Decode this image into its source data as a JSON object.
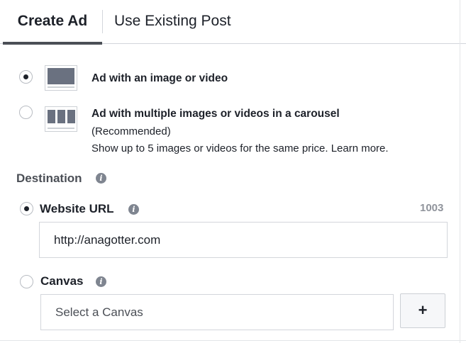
{
  "tabs": {
    "create_ad": "Create Ad",
    "use_existing_post": "Use Existing Post"
  },
  "format_options": {
    "single": {
      "title": "Ad with an image or video",
      "selected": true
    },
    "carousel": {
      "title": "Ad with multiple images or videos in a carousel",
      "recommended": "(Recommended)",
      "description": "Show up to 5 images or videos for the same price.",
      "learn_more": "Learn more.",
      "selected": false
    }
  },
  "destination": {
    "label": "Destination",
    "info_glyph": "i",
    "website_url": {
      "label": "Website URL",
      "char_counter": "1003",
      "value": "http://anagotter.com",
      "selected": true
    },
    "canvas": {
      "label": "Canvas",
      "placeholder": "Select a Canvas",
      "add_label": "+",
      "selected": false
    }
  },
  "colors": {
    "text": "#1d2129",
    "muted": "#90949c",
    "border": "#d3d6db",
    "icon": "#6a7180"
  }
}
